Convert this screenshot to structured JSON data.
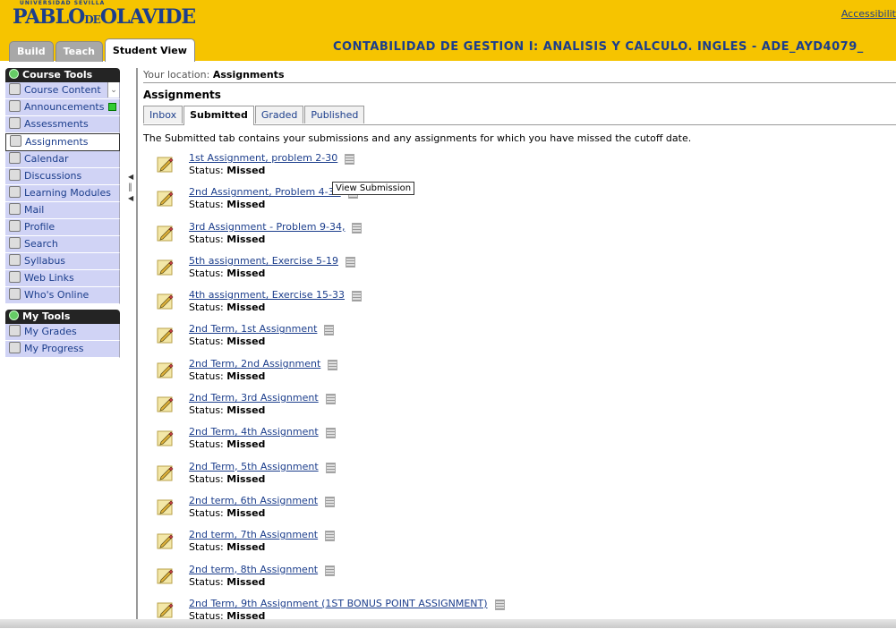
{
  "header": {
    "logo": {
      "top": "UNIVERSIDAD SEVILLA",
      "main_left": "PABLO",
      "connector": "DE",
      "main_right": "OLAVIDE"
    },
    "accessibility": "Accessibilit",
    "tabs": [
      "Build",
      "Teach",
      "Student View"
    ],
    "course_title": "CONTABILIDAD DE GESTION I: ANALISIS Y CALCULO. INGLES - ADE_AYD4079_"
  },
  "sidebar": {
    "course_tools_title": "Course Tools",
    "items": [
      {
        "label": "Course Content",
        "icon": "home-icon"
      },
      {
        "label": "Announcements",
        "icon": "announcement-icon"
      },
      {
        "label": "Assessments",
        "icon": "assessment-icon"
      },
      {
        "label": "Assignments",
        "icon": "assignment-icon"
      },
      {
        "label": "Calendar",
        "icon": "calendar-icon"
      },
      {
        "label": "Discussions",
        "icon": "discussion-icon"
      },
      {
        "label": "Learning Modules",
        "icon": "module-icon"
      },
      {
        "label": "Mail",
        "icon": "mail-icon"
      },
      {
        "label": "Profile",
        "icon": "profile-icon"
      },
      {
        "label": "Search",
        "icon": "search-icon"
      },
      {
        "label": "Syllabus",
        "icon": "syllabus-icon"
      },
      {
        "label": "Web Links",
        "icon": "weblink-icon"
      },
      {
        "label": "Who's Online",
        "icon": "online-icon"
      }
    ],
    "my_tools_title": "My Tools",
    "my_tools": [
      {
        "label": "My Grades",
        "icon": "grades-icon"
      },
      {
        "label": "My Progress",
        "icon": "progress-icon"
      }
    ]
  },
  "main": {
    "location_label": "Your location:",
    "location_value": "Assignments",
    "title": "Assignments",
    "tabs": [
      "Inbox",
      "Submitted",
      "Graded",
      "Published"
    ],
    "description": "The Submitted tab contains your submissions and any assignments for which you have missed the cutoff date.",
    "status_label": "Status:",
    "tooltip": "View Submission",
    "assignments": [
      {
        "title": "1st Assignment, problem 2-30",
        "status": "Missed"
      },
      {
        "title": "2nd Assignment, Problem 4-31",
        "status": "Missed"
      },
      {
        "title": "3rd Assignment - Problem 9-34,",
        "status": "Missed"
      },
      {
        "title": "5th assignment, Exercise 5-19",
        "status": "Missed"
      },
      {
        "title": "4th assignment, Exercise 15-33",
        "status": "Missed"
      },
      {
        "title": "2nd Term, 1st Assignment",
        "status": "Missed"
      },
      {
        "title": "2nd Term, 2nd Assignment",
        "status": "Missed"
      },
      {
        "title": "2nd Term, 3rd Assignment",
        "status": "Missed"
      },
      {
        "title": "2nd Term, 4th Assignment",
        "status": "Missed"
      },
      {
        "title": "2nd Term, 5th Assignment",
        "status": "Missed"
      },
      {
        "title": "2nd term, 6th Assignment",
        "status": "Missed"
      },
      {
        "title": "2nd term, 7th Assignment",
        "status": "Missed"
      },
      {
        "title": "2nd term, 8th Assignment",
        "status": "Missed"
      },
      {
        "title": "2nd Term, 9th Assignment (1ST BONUS POINT ASSIGNMENT)",
        "status": "Missed"
      }
    ]
  }
}
